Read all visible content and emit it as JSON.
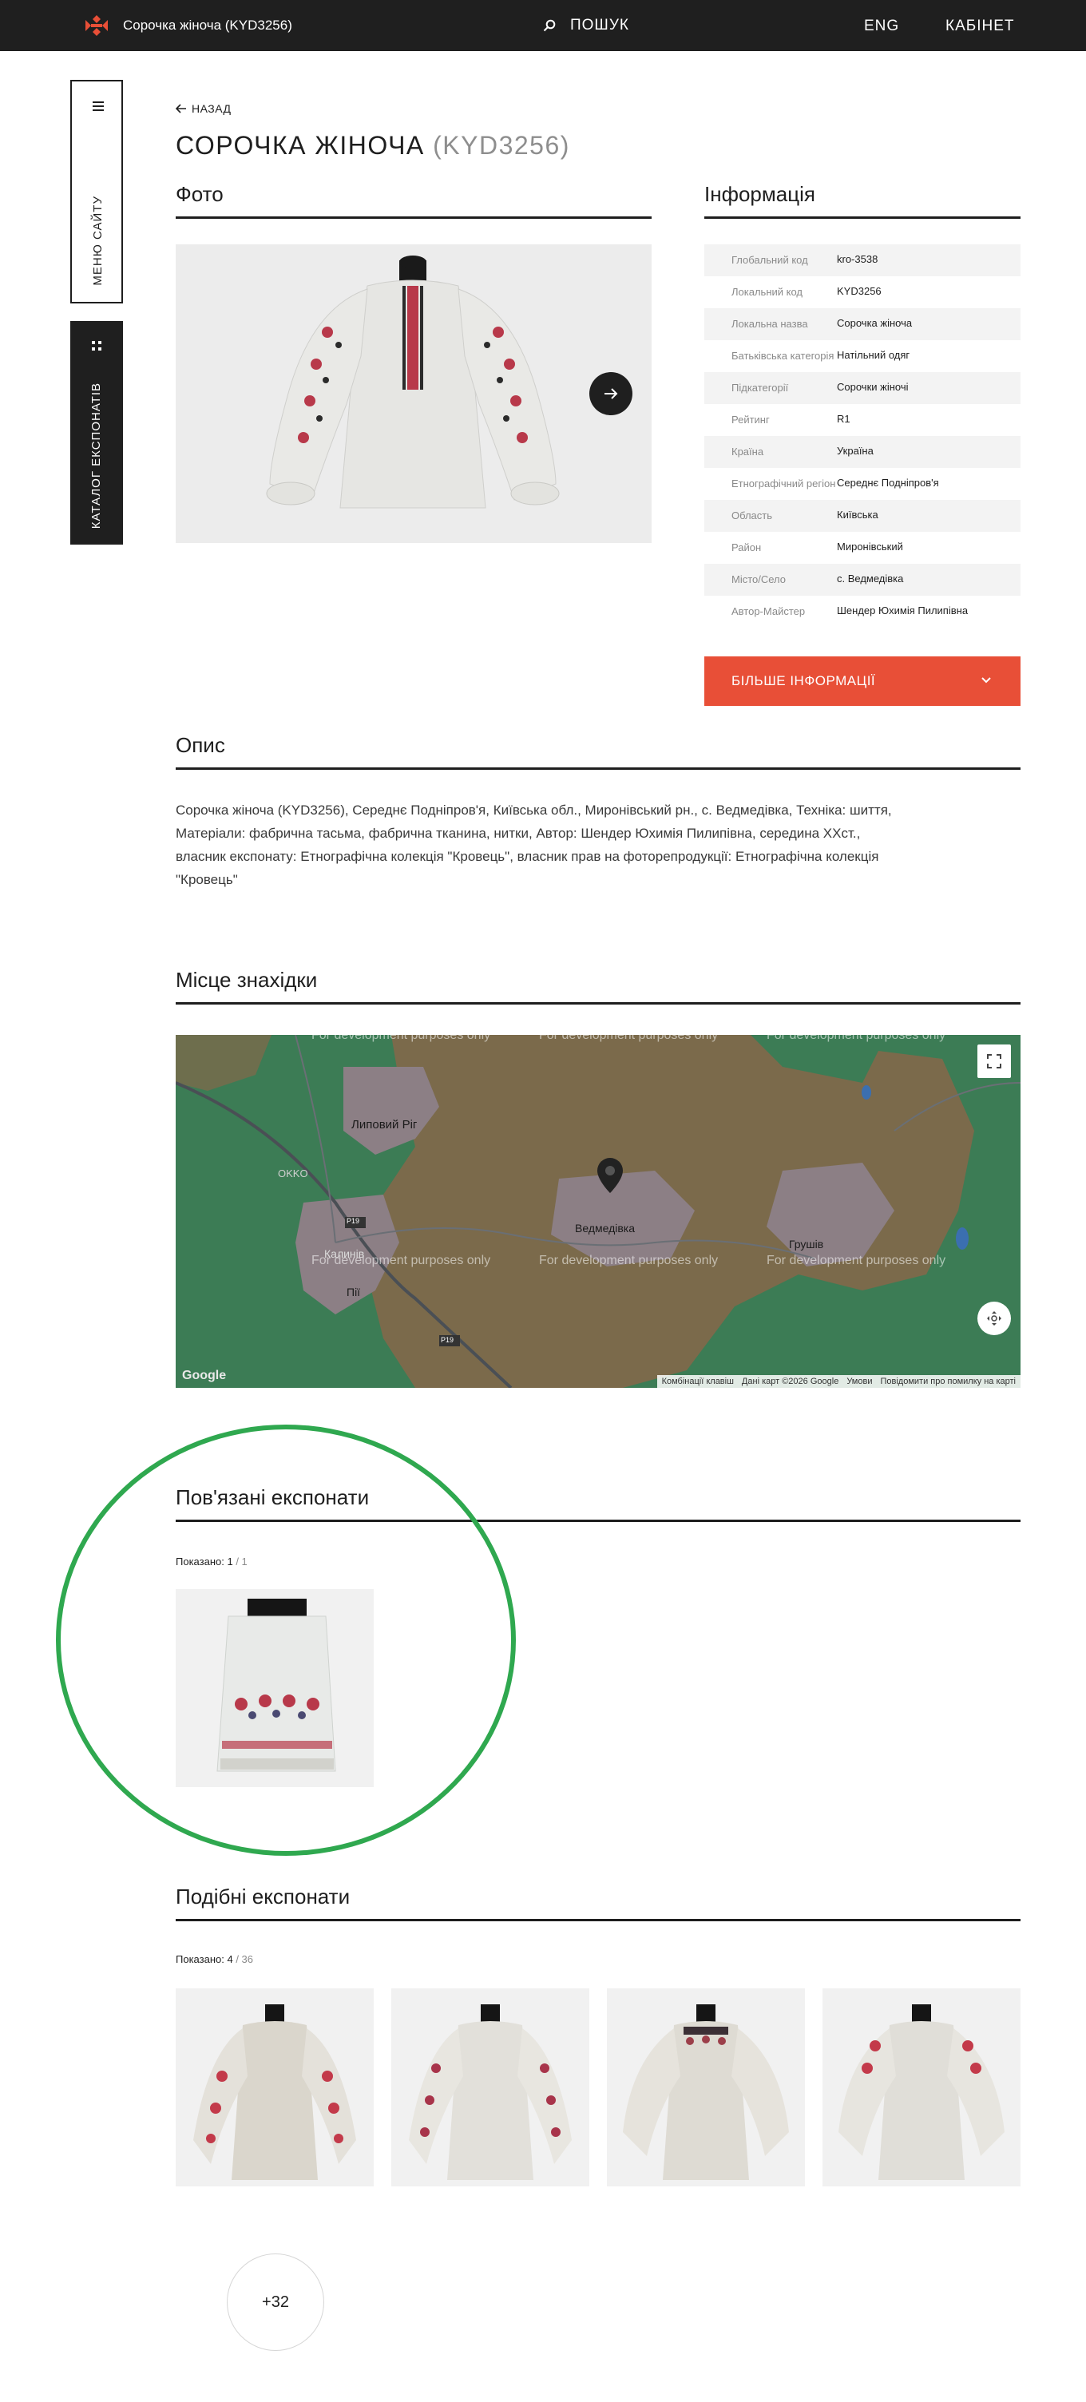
{
  "header": {
    "site_title": "Сорочка жіноча (KYD3256)",
    "search_label": "ПОШУК",
    "lang_label": "ENG",
    "cabinet_label": "КАБІНЕТ"
  },
  "sidebar": {
    "menu_label": "МЕНЮ САЙТУ",
    "catalog_label": "КАТАЛОГ ЕКСПОНАТІВ"
  },
  "page": {
    "back_label": "НАЗАД",
    "title_name": "СОРОЧКА ЖІНОЧА",
    "title_code": "(KYD3256)"
  },
  "photo_section": {
    "heading": "Фото"
  },
  "info_section": {
    "heading": "Інформація",
    "rows": [
      {
        "key": "Глобальний код",
        "value": "kro-3538"
      },
      {
        "key": "Локальний код",
        "value": "KYD3256"
      },
      {
        "key": "Локальна назва",
        "value": "Сорочка жіноча"
      },
      {
        "key": "Батьківська категорія",
        "value": "Натільний одяг"
      },
      {
        "key": "Підкатегорії",
        "value": "Сорочки жіночі"
      },
      {
        "key": "Рейтинг",
        "value": "R1"
      },
      {
        "key": "Країна",
        "value": "Україна"
      },
      {
        "key": "Етнографічний регіон",
        "value": "Середнє Подніпров'я"
      },
      {
        "key": "Область",
        "value": "Київська"
      },
      {
        "key": "Район",
        "value": "Миронівський"
      },
      {
        "key": "Місто/Село",
        "value": "с. Ведмедівка"
      },
      {
        "key": "Автор-Майстер",
        "value": "Шендер Юхимія Пилипівна"
      }
    ],
    "more_button": "БІЛЬШЕ ІНФОРМАЦІЇ"
  },
  "description": {
    "heading": "Опис",
    "text": "Сорочка жіноча (KYD3256), Середнє Подніпров'я, Київська обл., Миронівський рн., с. Ведмедівка, Техніка: шиття, Матеріали: фабрична тасьма, фабрична тканина, нитки, Автор: Шендер Юхимія Пилипівна, середина ХХст., власник експонату: Етнографічна колекція \"Кровець\", власник прав на фоторепродукції: Етнографічна колекція \"Кровець\""
  },
  "location": {
    "heading": "Місце знахідки",
    "watermark": "For development purposes only",
    "places": [
      "Липовий Ріг",
      "Ведмедівка",
      "Грушів",
      "Калинів",
      "Пії",
      "OKKO"
    ],
    "road_labels": [
      "P19",
      "P19"
    ],
    "footer": [
      "Комбінації клавіш",
      "Дані карт ©2026 Google",
      "Умови",
      "Повідомити про помилку на карті"
    ],
    "brand": "Google"
  },
  "related": {
    "heading": "Пов'язані експонати",
    "shown_label": "Показано:",
    "shown_count": "1",
    "shown_total": "/ 1"
  },
  "similar": {
    "heading": "Подібні експонати",
    "shown_label": "Показано:",
    "shown_count": "4",
    "shown_total": "/ 36",
    "more_label": "+32"
  },
  "colors": {
    "header_bg": "#1f1f1f",
    "accent": "#e84f37",
    "highlight_ring": "#2fa84f"
  }
}
